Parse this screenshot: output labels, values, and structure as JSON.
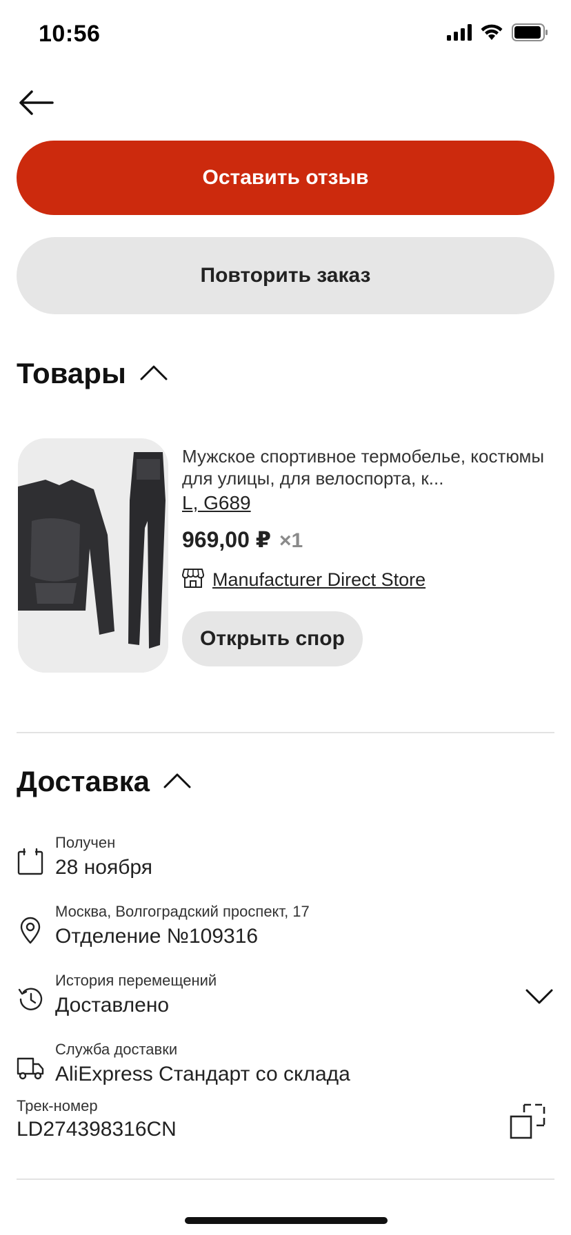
{
  "status_bar": {
    "time": "10:56",
    "icons": [
      "cellular-signal-icon",
      "wifi-icon",
      "battery-icon"
    ]
  },
  "nav": {
    "back_icon": "arrow-left-icon"
  },
  "actions": {
    "leave_review": "Оставить отзыв",
    "repeat_order": "Повторить заказ"
  },
  "products_section": {
    "title": "Товары",
    "toggle_icon": "chevron-up-icon",
    "items": [
      {
        "title": "Мужское спортивное термобелье, костюмы для улицы, для велоспорта, к...",
        "variant": "L, G689",
        "price": "969,00 ₽",
        "quantity": "×1",
        "store_icon": "store-icon",
        "store": "Manufacturer Direct Store",
        "dispute_label": "Открыть спор"
      }
    ]
  },
  "delivery_section": {
    "title": "Доставка",
    "toggle_icon": "chevron-up-icon",
    "rows": [
      {
        "icon": "calendar-icon",
        "label": "Получен",
        "value": "28 ноября"
      },
      {
        "icon": "location-pin-icon",
        "label": "Москва, Волгоградский проспект, 17",
        "value": "Отделение №109316"
      },
      {
        "icon": "history-icon",
        "label": "История перемещений",
        "value": "Доставлено",
        "expand_icon": "chevron-down-icon"
      },
      {
        "icon": "truck-icon",
        "label": "Служба доставки",
        "value": "AliExpress Стандарт со склада"
      }
    ],
    "track": {
      "label": "Трек-номер",
      "value": "LD274398316CN",
      "copy_icon": "copy-icon"
    }
  },
  "colors": {
    "primary": "#cc2a0d",
    "secondary_bg": "#e6e6e6",
    "text": "#222222",
    "muted": "#8a8a8a"
  }
}
